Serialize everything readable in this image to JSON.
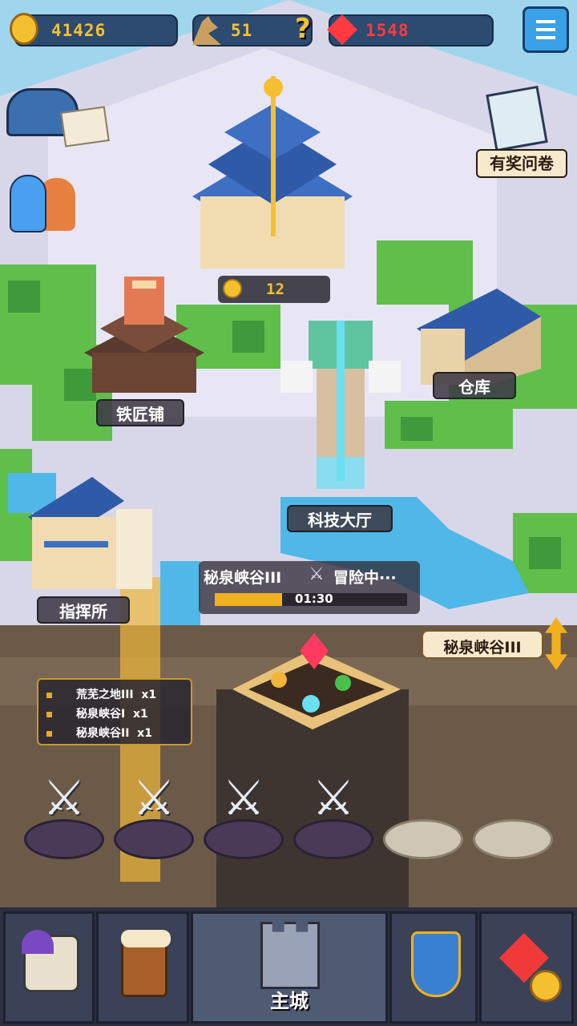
{
  "top_bar": {
    "gold": "41426",
    "wheat": "51",
    "help_icon": "?",
    "gems": "1548"
  },
  "left_icons": [
    "mailbox-icon",
    "friends-icon"
  ],
  "survey": {
    "label": "有奖问卷"
  },
  "buildings": {
    "palace_income": "12",
    "blacksmith": "铁匠铺",
    "warehouse": "仓库",
    "tech_hall": "科技大厅",
    "command_post": "指挥所"
  },
  "adventure": {
    "stage": "秘泉峡谷III",
    "status": "冒险中···",
    "timer": "01:30",
    "progress": 0.35
  },
  "current_stage_selector": "秘泉峡谷III",
  "reward_queue": [
    {
      "name": "荒芜之地III",
      "count": "x1"
    },
    {
      "name": "秘泉峡谷I",
      "count": "x1"
    },
    {
      "name": "秘泉峡谷II",
      "count": "x1"
    }
  ],
  "hero_slots": {
    "filled": 4,
    "empty": 2
  },
  "bottom_nav": [
    {
      "icon": "heroes-icon",
      "label": ""
    },
    {
      "icon": "tavern-icon",
      "label": ""
    },
    {
      "icon": "castle-icon",
      "label": "主城"
    },
    {
      "icon": "battle-shield-icon",
      "label": ""
    },
    {
      "icon": "shop-icon",
      "label": ""
    }
  ],
  "colors": {
    "gold": "#f5c030",
    "wheat": "#f5c030",
    "gems": "#ff3a40"
  }
}
